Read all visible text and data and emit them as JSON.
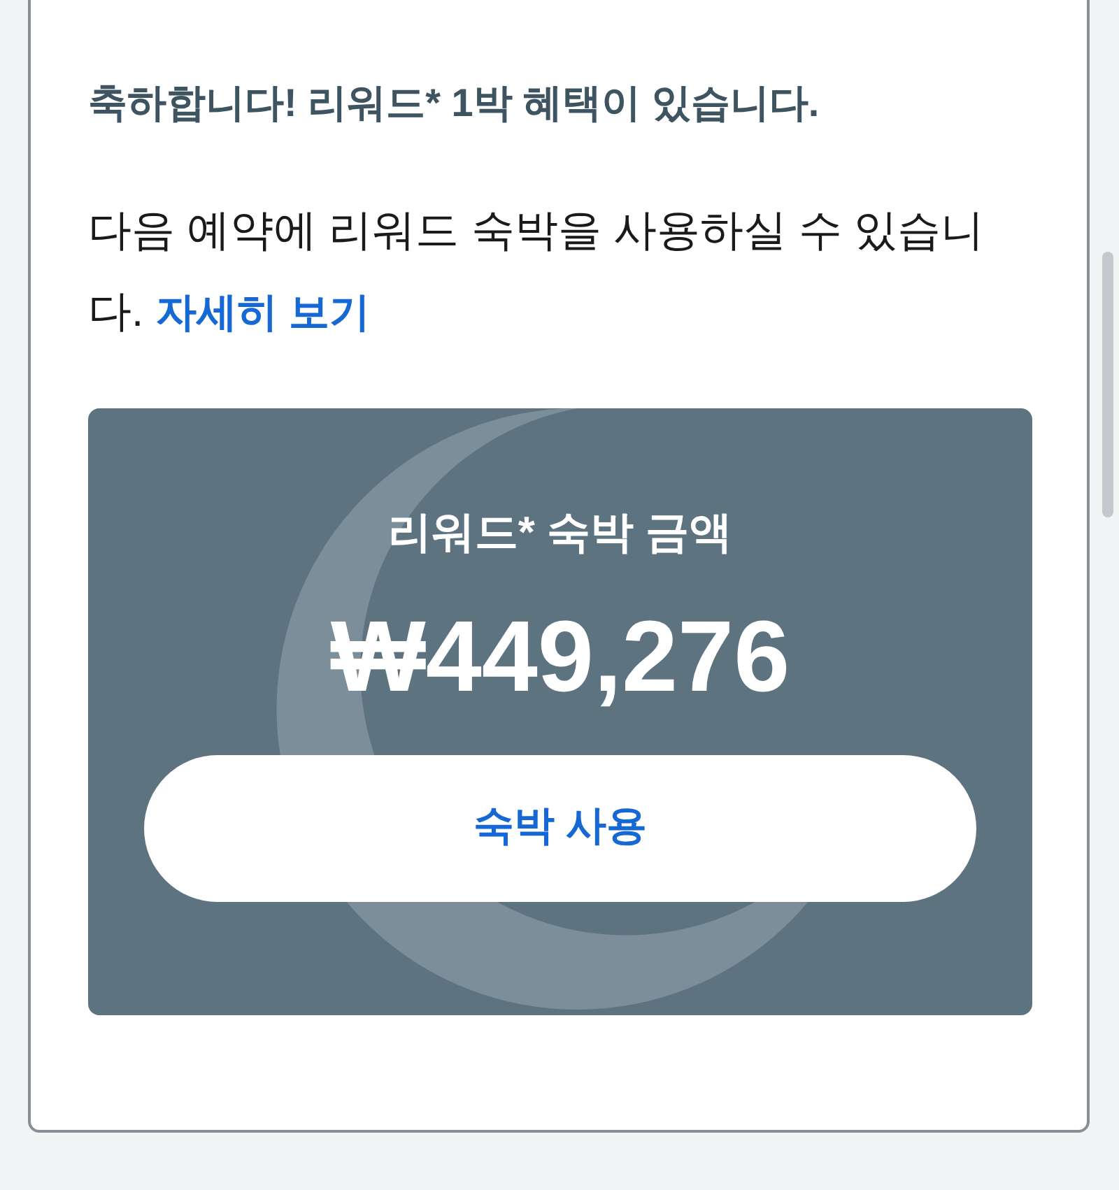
{
  "heading": "축하합니다! 리워드* 1박 혜택이 있습니다.",
  "message": {
    "text": "다음 예약에 리워드 숙박을 사용하실 수 있습니다.",
    "link": "자세히 보기"
  },
  "reward": {
    "label": "리워드* 숙박 금액",
    "amount": "₩449,276",
    "button": "숙박 사용"
  }
}
